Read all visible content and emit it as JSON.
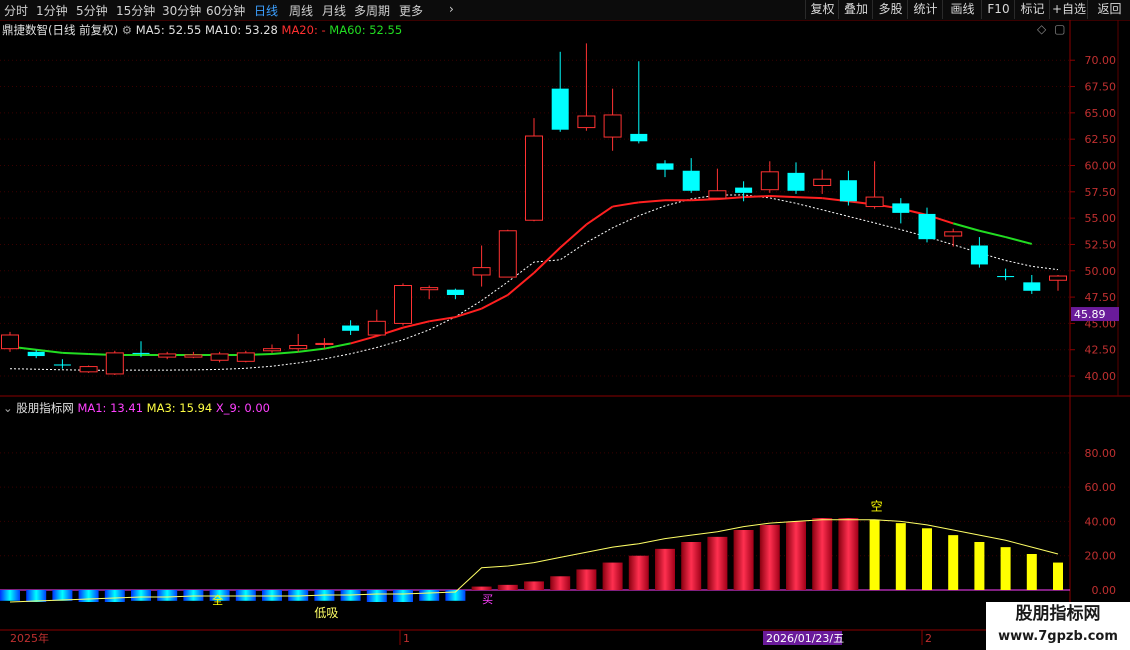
{
  "toolbar": {
    "periods": [
      "分时",
      "1分钟",
      "5分钟",
      "15分钟",
      "30分钟",
      "60分钟",
      "日线",
      "周线",
      "月线",
      "多周期",
      "更多"
    ],
    "active_period": "日线",
    "buttons": [
      "复权",
      "叠加",
      "多股",
      "统计",
      "画线",
      "F10",
      "标记",
      "+自选",
      "返回"
    ]
  },
  "main_legend": {
    "stock": "鼎捷数智(日线 前复权)",
    "ma5": "MA5: 52.55",
    "ma10": "MA10: 53.28",
    "ma20": "MA20: -",
    "ma60": "MA60: 52.55"
  },
  "sub_legend": {
    "name": "股朋指标网",
    "ma1": "MA1: 13.41",
    "ma3": "MA3: 15.94",
    "x9": "X_9: 0.00"
  },
  "colors": {
    "up": "#ff3232",
    "down": "#00ffff",
    "ma_red": "#ff2020",
    "ma_green": "#22dd22",
    "ma_white": "#ffffff",
    "yellow": "#ffff00",
    "magenta": "#ff40ff",
    "price_tag": "#6a1b9a"
  },
  "price_tag": "45.89",
  "date_axis": {
    "start": "2025年",
    "m1": "1",
    "current": "2026/01/23/五",
    "m2": "2"
  },
  "sub_annotations": {
    "kong_top": "空",
    "quan": "全",
    "di_xi": "低吸",
    "mai": "买"
  },
  "watermark": {
    "title": "股朋指标网",
    "url": "www.7gpzb.com"
  },
  "chart_data": [
    {
      "type": "candlestick",
      "y_ticks": [
        "70.00",
        "67.50",
        "65.00",
        "62.50",
        "60.00",
        "57.50",
        "55.00",
        "52.50",
        "50.00",
        "47.50",
        "45.00",
        "42.50",
        "40.00"
      ],
      "ylim": [
        38.2,
        72.3
      ],
      "candles": [
        {
          "o": 42.6,
          "c": 43.9,
          "h": 44.2,
          "l": 42.3
        },
        {
          "o": 42.3,
          "c": 41.9,
          "h": 42.5,
          "l": 41.7
        },
        {
          "o": 41.1,
          "c": 41.0,
          "h": 41.6,
          "l": 40.7
        },
        {
          "o": 40.4,
          "c": 40.9,
          "h": 41.0,
          "l": 40.3
        },
        {
          "o": 40.2,
          "c": 42.2,
          "h": 42.4,
          "l": 40.1
        },
        {
          "o": 42.2,
          "c": 42.1,
          "h": 43.3,
          "l": 41.8
        },
        {
          "o": 41.8,
          "c": 42.1,
          "h": 42.3,
          "l": 41.6
        },
        {
          "o": 41.8,
          "c": 42.0,
          "h": 42.3,
          "l": 41.7
        },
        {
          "o": 41.5,
          "c": 42.1,
          "h": 42.3,
          "l": 41.3
        },
        {
          "o": 41.4,
          "c": 42.2,
          "h": 42.4,
          "l": 41.3
        },
        {
          "o": 42.4,
          "c": 42.6,
          "h": 43.0,
          "l": 42.2
        },
        {
          "o": 42.6,
          "c": 42.9,
          "h": 44.0,
          "l": 42.3
        },
        {
          "o": 43.0,
          "c": 43.1,
          "h": 43.6,
          "l": 42.6
        },
        {
          "o": 44.8,
          "c": 44.3,
          "h": 45.3,
          "l": 43.9
        },
        {
          "o": 43.9,
          "c": 45.2,
          "h": 46.3,
          "l": 43.8
        },
        {
          "o": 45.0,
          "c": 48.6,
          "h": 48.8,
          "l": 44.8
        },
        {
          "o": 48.2,
          "c": 48.4,
          "h": 48.6,
          "l": 47.3
        },
        {
          "o": 48.2,
          "c": 47.7,
          "h": 48.3,
          "l": 47.3
        },
        {
          "o": 49.6,
          "c": 50.3,
          "h": 52.4,
          "l": 48.5
        },
        {
          "o": 49.4,
          "c": 53.8,
          "h": 53.9,
          "l": 49.4
        },
        {
          "o": 54.8,
          "c": 62.8,
          "h": 64.5,
          "l": 54.7
        },
        {
          "o": 67.3,
          "c": 63.4,
          "h": 70.8,
          "l": 63.2
        },
        {
          "o": 63.6,
          "c": 64.7,
          "h": 71.6,
          "l": 63.3
        },
        {
          "o": 62.7,
          "c": 64.8,
          "h": 67.3,
          "l": 61.4
        },
        {
          "o": 63.0,
          "c": 62.3,
          "h": 69.9,
          "l": 62.1
        },
        {
          "o": 60.2,
          "c": 59.6,
          "h": 60.5,
          "l": 58.9
        },
        {
          "o": 59.5,
          "c": 57.6,
          "h": 60.7,
          "l": 57.4
        },
        {
          "o": 56.9,
          "c": 57.6,
          "h": 59.7,
          "l": 56.8
        },
        {
          "o": 57.9,
          "c": 57.4,
          "h": 58.5,
          "l": 56.6
        },
        {
          "o": 57.7,
          "c": 59.4,
          "h": 60.4,
          "l": 57.4
        },
        {
          "o": 59.3,
          "c": 57.6,
          "h": 60.3,
          "l": 57.3
        },
        {
          "o": 58.1,
          "c": 58.7,
          "h": 59.6,
          "l": 57.3
        },
        {
          "o": 58.6,
          "c": 56.6,
          "h": 59.5,
          "l": 56.2
        },
        {
          "o": 56.1,
          "c": 57.0,
          "h": 60.4,
          "l": 55.9
        },
        {
          "o": 56.4,
          "c": 55.5,
          "h": 56.9,
          "l": 54.5
        },
        {
          "o": 55.4,
          "c": 53.0,
          "h": 56.0,
          "l": 52.7
        },
        {
          "o": 53.3,
          "c": 53.7,
          "h": 54.0,
          "l": 52.3
        },
        {
          "o": 52.4,
          "c": 50.6,
          "h": 53.2,
          "l": 50.3
        },
        {
          "o": 49.5,
          "c": 49.4,
          "h": 50.2,
          "l": 49.1
        },
        {
          "o": 48.9,
          "c": 48.1,
          "h": 49.6,
          "l": 47.8
        },
        {
          "o": 49.1,
          "c": 49.5,
          "h": 49.6,
          "l": 48.1
        }
      ],
      "ma_red": [
        42.8,
        42.5,
        42.2,
        42.1,
        42.0,
        42.0,
        42.0,
        42.0,
        42.0,
        42.0,
        42.1,
        42.3,
        42.6,
        43.1,
        43.8,
        44.6,
        45.2,
        45.6,
        46.4,
        47.7,
        49.8,
        52.2,
        54.4,
        56.1,
        56.5,
        56.7,
        56.7,
        56.8,
        57.0,
        57.1,
        57.0,
        56.9,
        56.6,
        56.3,
        55.9,
        55.3,
        54.5,
        53.8,
        53.2,
        52.55
      ]
    },
    {
      "type": "bar",
      "ylim": [
        0,
        105
      ],
      "y_ticks": [
        "80.00",
        "60.00",
        "40.00",
        "20.00",
        "0.00"
      ],
      "bars": [
        9,
        10,
        9,
        10,
        10,
        9,
        9,
        9,
        9,
        9,
        9,
        9,
        9,
        9,
        10,
        10,
        9,
        9,
        2,
        3,
        5,
        8,
        12,
        16,
        20,
        24,
        28,
        31,
        35,
        38,
        40,
        42,
        42,
        41,
        39,
        36,
        32,
        28,
        25,
        21,
        16
      ],
      "bar_colors": [
        "cyan",
        "cyan",
        "cyan",
        "cyan",
        "cyan",
        "cyan",
        "cyan",
        "cyan",
        "cyan",
        "cyan",
        "cyan",
        "cyan",
        "cyan",
        "cyan",
        "cyan",
        "cyan",
        "cyan",
        "cyan",
        "red",
        "red",
        "red",
        "red",
        "red",
        "red",
        "red",
        "red",
        "red",
        "red",
        "red",
        "red",
        "red",
        "red",
        "red",
        "yellow",
        "yellow",
        "yellow",
        "yellow",
        "yellow",
        "yellow",
        "yellow",
        "yellow"
      ],
      "line_ma3": [
        2,
        3,
        4,
        5,
        6,
        7,
        7,
        8,
        8,
        8,
        8,
        8,
        9,
        9,
        10,
        10,
        11,
        12,
        13,
        14,
        16,
        19,
        22,
        25,
        27,
        30,
        32,
        34,
        37,
        39,
        40,
        41,
        41,
        41,
        40,
        38,
        35,
        32,
        29,
        25,
        21
      ]
    }
  ]
}
